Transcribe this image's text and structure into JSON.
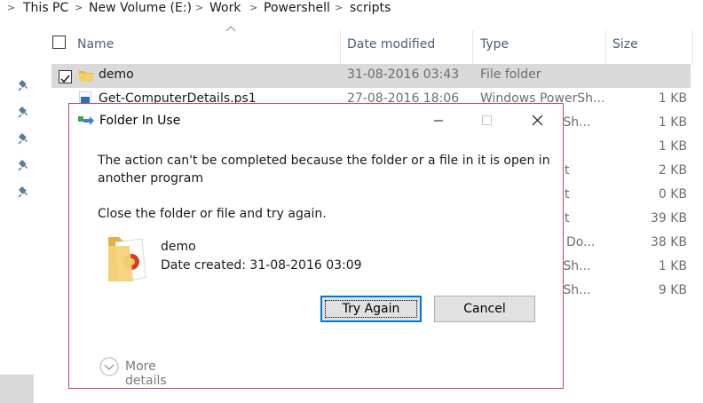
{
  "breadcrumb": {
    "items": [
      "This PC",
      "New Volume (E:)",
      "Work",
      "Powershell",
      "scripts"
    ],
    "separator": ">"
  },
  "columns": {
    "name": "Name",
    "date_modified": "Date modified",
    "type": "Type",
    "size": "Size"
  },
  "files": [
    {
      "name": "demo",
      "date": "31-08-2016 03:43",
      "type": "File folder",
      "size": "",
      "selected": true,
      "checked": true,
      "icon": "folder-icon"
    },
    {
      "name": "Get-ComputerDetails.ps1",
      "date": "27-08-2016 18:06",
      "type": "Windows PowerSh...",
      "size": "1 KB",
      "icon": "powershell-file-icon"
    },
    {
      "name": "",
      "date": "",
      "type": "erSh...",
      "size": "1 KB",
      "icon": ""
    },
    {
      "name": "",
      "date": "",
      "type": "",
      "size": "1 KB",
      "icon": ""
    },
    {
      "name": "",
      "date": "",
      "type": "t",
      "size": "2 KB",
      "icon": ""
    },
    {
      "name": "",
      "date": "",
      "type": "t",
      "size": "0 KB",
      "icon": ""
    },
    {
      "name": "",
      "date": "",
      "type": "t",
      "size": "39 KB",
      "icon": ""
    },
    {
      "name": "",
      "date": "",
      "type": "Do...",
      "size": "38 KB",
      "icon": ""
    },
    {
      "name": "",
      "date": "",
      "type": "erSh...",
      "size": "1 KB",
      "icon": ""
    },
    {
      "name": "",
      "date": "",
      "type": "erSh...",
      "size": "9 KB",
      "icon": ""
    }
  ],
  "dialog": {
    "title": "Folder In Use",
    "message_line1": "The action can't be completed because the folder or a file in it is open in",
    "message_line2": "another program",
    "instruction": "Close the folder or file and try again.",
    "item_name": "demo",
    "item_date": "Date created: 31-08-2016 03:09",
    "try_again": "Try Again",
    "cancel": "Cancel",
    "more_details": "More details"
  },
  "colors": {
    "dialog_border": "#c0446c",
    "selection": "#d9d9d9",
    "header_text": "#4c607a",
    "default_button_border": "#0078d7"
  }
}
